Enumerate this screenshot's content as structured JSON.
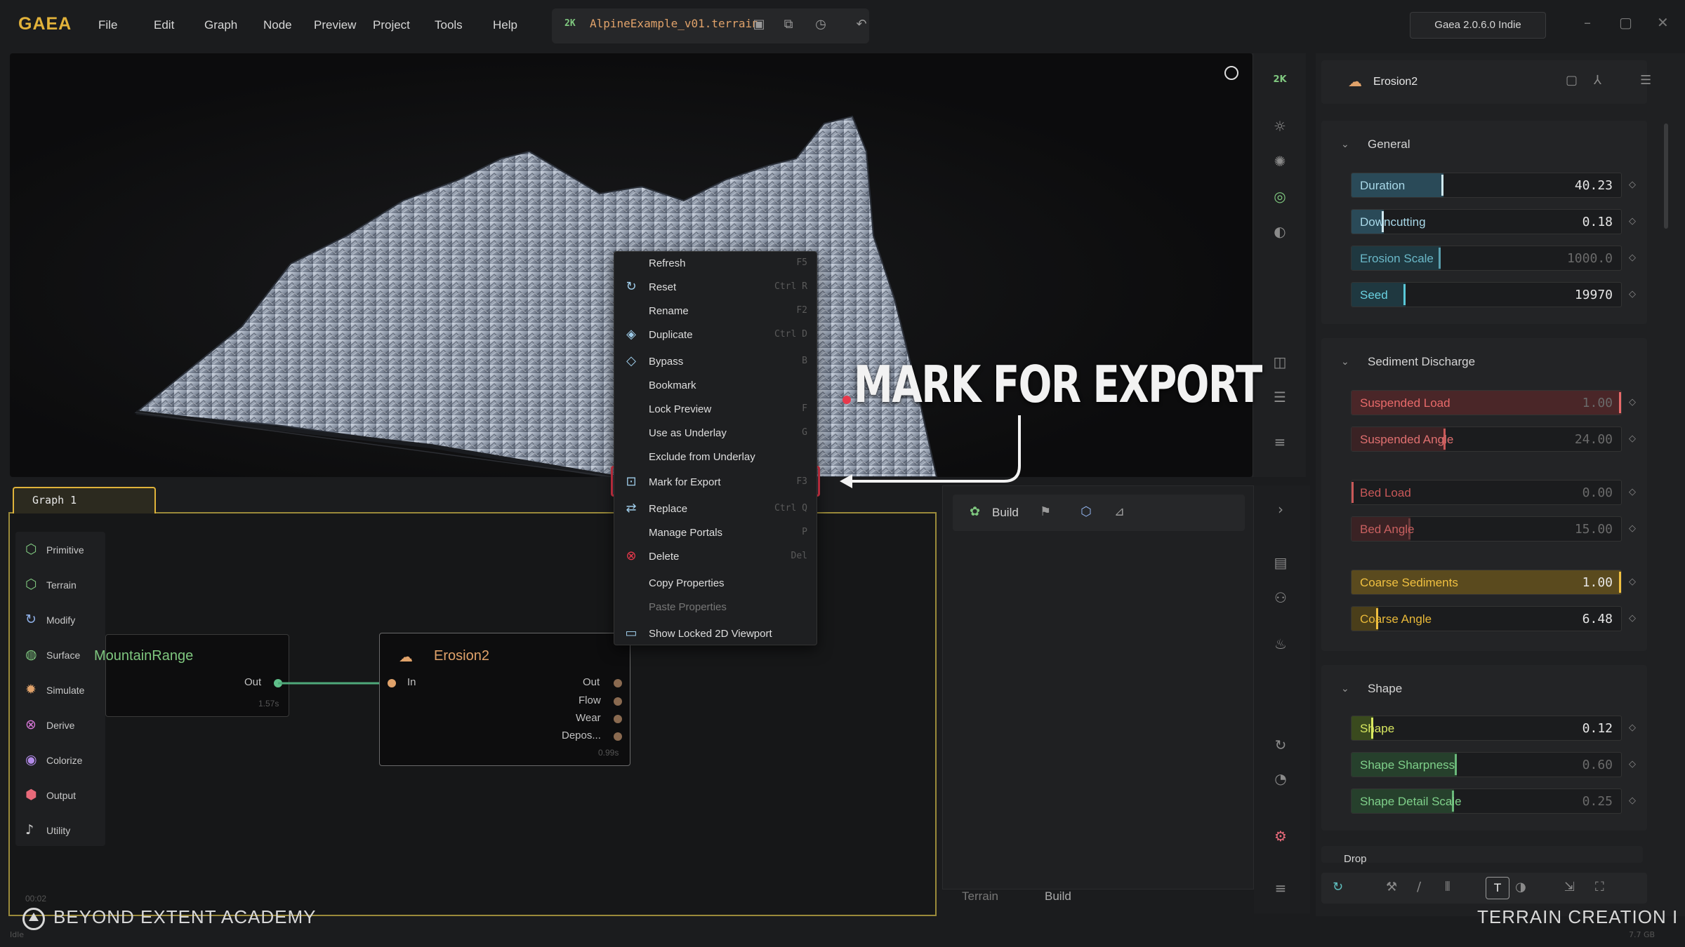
{
  "app": {
    "logo": "GAEA",
    "version": "Gaea 2.0.6.0 Indie"
  },
  "menu": [
    "File",
    "Edit",
    "Graph",
    "Node",
    "Preview",
    "Project",
    "Tools",
    "Help"
  ],
  "file": {
    "resolution": "2K",
    "name": "AlpineExample_v01.terrain"
  },
  "viewport": {
    "resolution_badge": "2K"
  },
  "graph": {
    "tab_label": "Graph 1",
    "palette": [
      "Primitive",
      "Terrain",
      "Modify",
      "Surface",
      "Simulate",
      "Derive",
      "Colorize",
      "Output",
      "Utility"
    ],
    "nodes": {
      "mountain": {
        "title": "MountainRange",
        "port_out": "Out",
        "time": "1.57s"
      },
      "erosion": {
        "title": "Erosion2",
        "port_in": "In",
        "outputs": [
          "Out",
          "Flow",
          "Wear",
          "Depos..."
        ],
        "time": "0.99s"
      }
    },
    "status_time": "00:02"
  },
  "context_menu": [
    {
      "label": "Refresh",
      "shortcut": "F5",
      "icon": ""
    },
    {
      "label": "Reset",
      "shortcut": "Ctrl R",
      "icon": "reset-icon"
    },
    {
      "label": "Rename",
      "shortcut": "F2",
      "icon": ""
    },
    {
      "label": "Duplicate",
      "shortcut": "Ctrl D",
      "icon": "layers-icon"
    },
    {
      "label": "Bypass",
      "shortcut": "B",
      "icon": "bypass-icon"
    },
    {
      "label": "Bookmark",
      "shortcut": "",
      "icon": ""
    },
    {
      "label": "Lock Preview",
      "shortcut": "F",
      "icon": ""
    },
    {
      "label": "Use as Underlay",
      "shortcut": "G",
      "icon": ""
    },
    {
      "label": "Exclude from Underlay",
      "shortcut": "",
      "icon": ""
    },
    {
      "label": "Mark for Export",
      "shortcut": "F3",
      "icon": "export-icon"
    },
    {
      "label": "Replace",
      "shortcut": "Ctrl Q",
      "icon": "replace-icon"
    },
    {
      "label": "Manage Portals",
      "shortcut": "P",
      "icon": ""
    },
    {
      "label": "Delete",
      "shortcut": "Del",
      "icon": "delete-icon"
    },
    {
      "label": "Copy Properties",
      "shortcut": "",
      "icon": ""
    },
    {
      "label": "Paste Properties",
      "shortcut": "",
      "icon": ""
    },
    {
      "label": "Show Locked 2D Viewport",
      "shortcut": "",
      "icon": "viewport-icon"
    }
  ],
  "annotation": "MARK FOR EXPORT",
  "build_panel": {
    "build_label": "Build",
    "tabs": [
      "Terrain",
      "Build"
    ]
  },
  "properties": {
    "node_title": "Erosion2",
    "sections": [
      {
        "title": "General",
        "params": [
          {
            "label": "Duration",
            "value": "40.23",
            "fraction": 0.34
          },
          {
            "label": "Downcutting",
            "value": "0.18",
            "fraction": 0.12
          },
          {
            "label": "Erosion Scale",
            "value": "1000.0",
            "fraction": 0.33
          },
          {
            "label": "Seed",
            "value": "19970",
            "fraction": 0.2
          }
        ]
      },
      {
        "title": "Sediment Discharge",
        "params": [
          {
            "label": "Suspended Load",
            "value": "1.00",
            "fraction": 1.0
          },
          {
            "label": "Suspended Angle",
            "value": "24.00",
            "fraction": 0.35
          },
          {
            "label": "Bed Load",
            "value": "0.00",
            "fraction": 0.0
          },
          {
            "label": "Bed Angle",
            "value": "15.00",
            "fraction": 0.22
          },
          {
            "label": "Coarse Sediments",
            "value": "1.00",
            "fraction": 1.0
          },
          {
            "label": "Coarse Angle",
            "value": "6.48",
            "fraction": 0.1
          }
        ]
      },
      {
        "title": "Shape",
        "params": [
          {
            "label": "Shape",
            "value": "0.12",
            "fraction": 0.08
          },
          {
            "label": "Shape Sharpness",
            "value": "0.60",
            "fraction": 0.39
          },
          {
            "label": "Shape Detail Scale",
            "value": "0.25",
            "fraction": 0.38
          }
        ]
      },
      {
        "title": "Drop",
        "params": []
      }
    ]
  },
  "footer": {
    "left": "BEYOND EXTENT ACADEMY",
    "right": "TERRAIN CREATION I",
    "status": "Idle",
    "memory": "7.7 GB"
  },
  "colors": {
    "accent": "#e0b33a",
    "highlight": "#e8394c",
    "node_green": "#7fc77f"
  }
}
